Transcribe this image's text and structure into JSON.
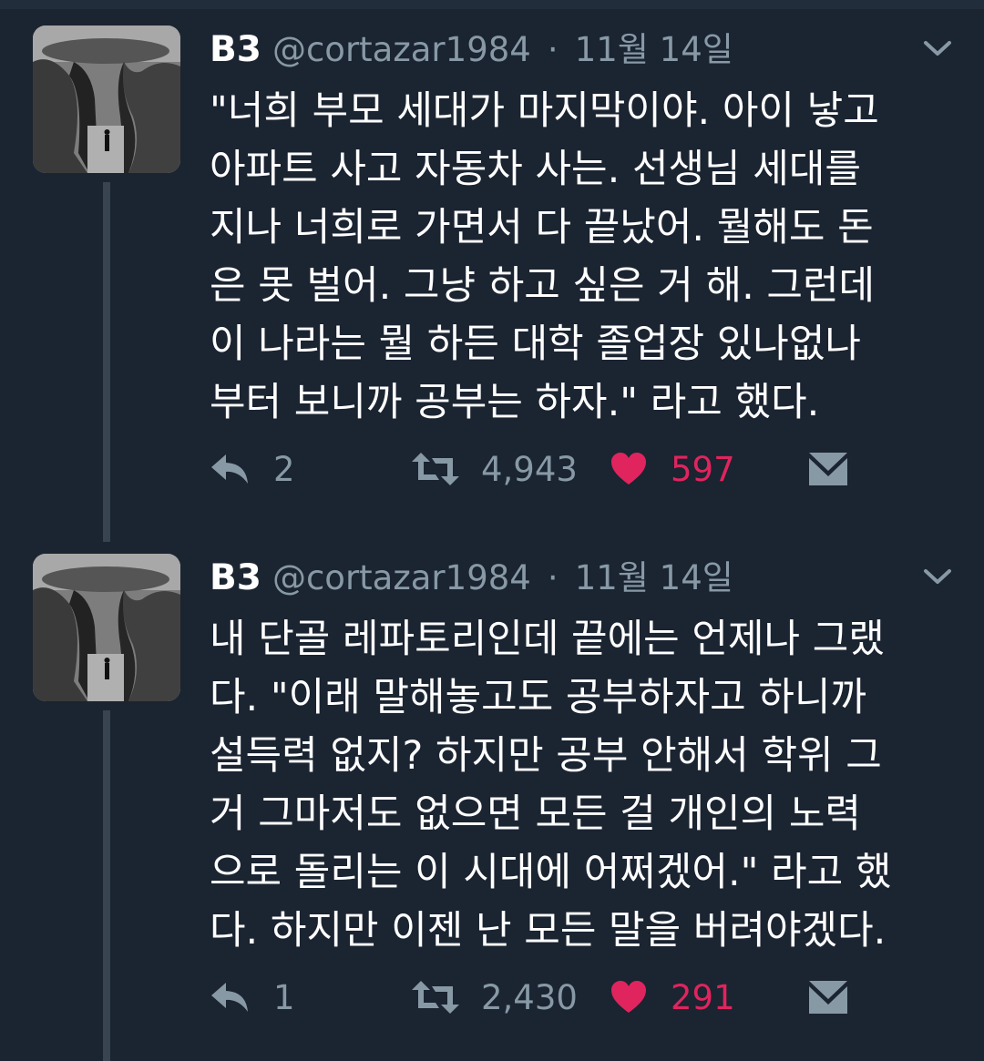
{
  "tweets": [
    {
      "name": "B3",
      "handle": "@cortazar1984",
      "separator": "·",
      "date": "11월 14일",
      "lines": [
        "\"너희 부모 세대가 마지막이야. 아이 낳고",
        "아파트 사고 자동차 사는. 선생님 세대를",
        "지나 너희로 가면서 다 끝났어. 뭘해도 돈",
        "은 못 벌어. 그냥 하고 싶은 거 해. 그런데",
        "이 나라는 뭘 하든 대학 졸업장 있나없나",
        "부터 보니까 공부는 하자.\" 라고 했다."
      ],
      "replies": "2",
      "retweets": "4,943",
      "likes": "597",
      "icons": [
        "reply-icon",
        "retweet-icon",
        "heart-icon",
        "message-icon",
        "chevron-down-icon"
      ]
    },
    {
      "name": "B3",
      "handle": "@cortazar1984",
      "separator": "·",
      "date": "11월 14일",
      "lines": [
        "내 단골 레파토리인데 끝에는 언제나 그랬",
        "다. \"이래 말해놓고도 공부하자고 하니까",
        "설득력 없지? 하지만 공부 안해서 학위 그",
        "거 그마저도 없으면 모든 걸 개인의 노력",
        "으로 돌리는 이 시대에 어쩌겠어.\" 라고 했",
        "다. 하지만 이젠 난 모든 말을 버려야겠다."
      ],
      "replies": "1",
      "retweets": "2,430",
      "likes": "291",
      "icons": [
        "reply-icon",
        "retweet-icon",
        "heart-icon",
        "message-icon",
        "chevron-down-icon"
      ]
    }
  ],
  "colors": {
    "background": "#1b2431",
    "secondary_text": "#8899a6",
    "like": "#e0245e",
    "thread_line": "#38444f"
  }
}
